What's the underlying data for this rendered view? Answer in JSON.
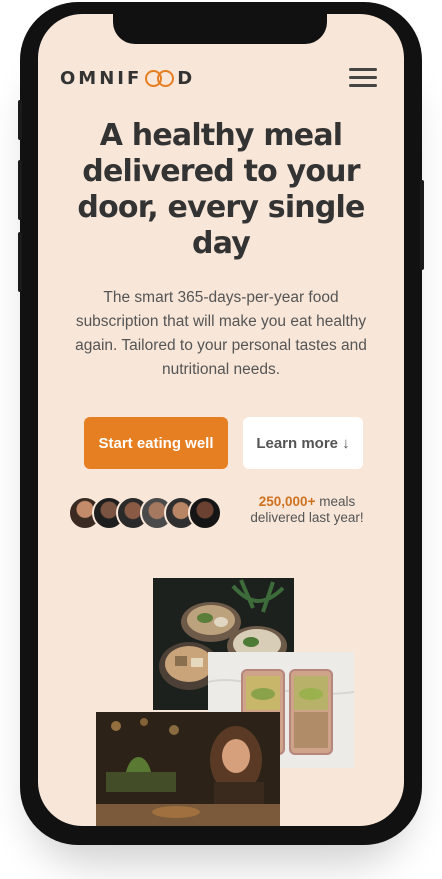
{
  "header": {
    "logo_left": "OMNIF",
    "logo_right": "D",
    "menu_icon": "hamburger-menu-icon"
  },
  "hero": {
    "title": "A healthy meal delivered to your door, every single day",
    "description": "The smart 365-days-per-year food subscription that will make you eat healthy again. Tailored to your personal tastes and nutritional needs.",
    "primary_cta": "Start eating well",
    "secondary_cta": "Learn more ↓",
    "delivered_count": "250,000+",
    "delivered_text": " meals delivered last year!"
  },
  "colors": {
    "accent": "#e67e22",
    "background": "#f8e6d8",
    "text": "#333333"
  }
}
